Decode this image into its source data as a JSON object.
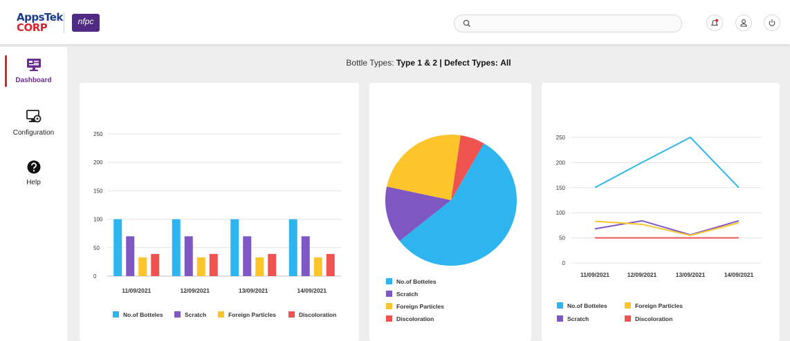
{
  "header": {
    "logo_apps": "AppsTek",
    "logo_corp": "CORP",
    "logo_nfpc": "nfpc",
    "search": {
      "value": "",
      "placeholder": ""
    },
    "icons": [
      "search-icon",
      "notification-bell-icon",
      "user-icon",
      "power-icon"
    ]
  },
  "sidebar": {
    "items": [
      {
        "label": "Dashboard",
        "icon": "dashboard-monitor-icon",
        "active": true
      },
      {
        "label": "Configuration",
        "icon": "configuration-gear-icon",
        "active": false
      },
      {
        "label": "Help",
        "icon": "help-question-icon",
        "active": false
      }
    ]
  },
  "filter": {
    "bottle_label": "Bottle Types:",
    "bottle_value": "Type 1 & 2",
    "separator": "|",
    "defect_label": "Defect Types:",
    "defect_value": "All"
  },
  "colors": {
    "bottles": "#2eb5f0",
    "scratch": "#7e57c2",
    "foreign": "#fcc52c",
    "discoloration": "#ef5350",
    "accent": "#d9262d",
    "brand_purple": "#4e2a84"
  },
  "legend_labels": {
    "bottles": "No.of Botteles",
    "scratch": "Scratch",
    "foreign": "Foreign Particles",
    "discoloration": "Discoloration"
  },
  "chart_data": [
    {
      "type": "bar",
      "title": "",
      "categories": [
        "11/09/2021",
        "12/09/2021",
        "13/09/2021",
        "14/09/2021"
      ],
      "series": [
        {
          "name": "No.of Botteles",
          "values": [
            100,
            100,
            100,
            100
          ]
        },
        {
          "name": "Scratch",
          "values": [
            70,
            70,
            70,
            70
          ]
        },
        {
          "name": "Foreign Particles",
          "values": [
            33,
            33,
            33,
            33
          ]
        },
        {
          "name": "Discoloration",
          "values": [
            39,
            39,
            39,
            39
          ]
        }
      ],
      "yticks": [
        "0",
        "50",
        "100",
        "150",
        "200",
        "250"
      ],
      "ylim": [
        0,
        250
      ],
      "grid": true,
      "legend": "bottom"
    },
    {
      "type": "pie",
      "title": "",
      "categories": [
        "No.of Botteles",
        "Scratch",
        "Foreign Particles",
        "Discoloration"
      ],
      "values": [
        56,
        14,
        24,
        6
      ],
      "legend": "bottom"
    },
    {
      "type": "line",
      "title": "",
      "categories": [
        "11/09/2021",
        "12/09/2021",
        "13/09/2021",
        "14/09/2021"
      ],
      "series": [
        {
          "name": "No.of Botteles",
          "values": [
            150,
            200,
            250,
            150
          ]
        },
        {
          "name": "Foreign Particles",
          "values": [
            83,
            77,
            55,
            80
          ]
        },
        {
          "name": "Scratch",
          "values": [
            68,
            84,
            56,
            84
          ]
        },
        {
          "name": "Discoloration",
          "values": [
            50,
            50,
            50,
            50
          ]
        }
      ],
      "yticks": [
        "0",
        "50",
        "100",
        "150",
        "200",
        "250"
      ],
      "ylim": [
        0,
        250
      ],
      "grid": true,
      "legend": "bottom"
    }
  ]
}
